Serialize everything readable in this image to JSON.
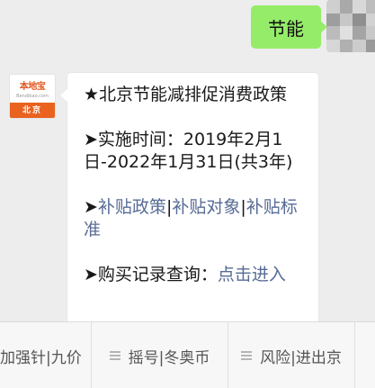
{
  "outgoing": {
    "text": "节能"
  },
  "account": {
    "logo_text": "本地宝",
    "logo_sub": "Bendibao.com",
    "city": "北京"
  },
  "message": {
    "title": "★北京节能减排促消费政策",
    "period_label": "➤实施时间：2019年2月1日-2022年1月31日(共3年)",
    "links_prefix": "➤",
    "link_policy": "补贴政策",
    "sep1": "|",
    "link_target": "补贴对象",
    "sep2": "|",
    "link_standard": "补贴标准",
    "query_label": "➤购买记录查询：",
    "query_link": "点击进入"
  },
  "menu": {
    "item1": "加强针|九价",
    "item2": "摇号|冬奥币",
    "item3": "风险|进出京",
    "item4": ""
  },
  "colors": {
    "outgoing_bubble": "#95ec69",
    "link": "#576b95",
    "brand": "#e9621e"
  }
}
